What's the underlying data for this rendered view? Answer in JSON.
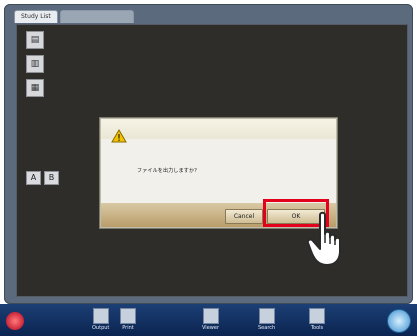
{
  "tabs": [
    {
      "label": "Study List"
    },
    {
      "label": ""
    }
  ],
  "left_tools": [
    {
      "icon": "document-icon"
    },
    {
      "icon": "folder-icon"
    },
    {
      "icon": "image-icon"
    }
  ],
  "mid_buttons": [
    {
      "label": "A"
    },
    {
      "label": "B"
    }
  ],
  "dialog": {
    "message": "ファイルを出力しますか？",
    "cancel_label": "Cancel",
    "ok_label": "OK"
  },
  "bottom_bar": {
    "items": [
      {
        "label": "Output"
      },
      {
        "label": "Print"
      },
      {
        "label": "Viewer"
      },
      {
        "label": "Search"
      },
      {
        "label": "Tools"
      }
    ]
  },
  "colors": {
    "highlight": "#e2001a",
    "bottom_bar": "#1c3f75"
  }
}
